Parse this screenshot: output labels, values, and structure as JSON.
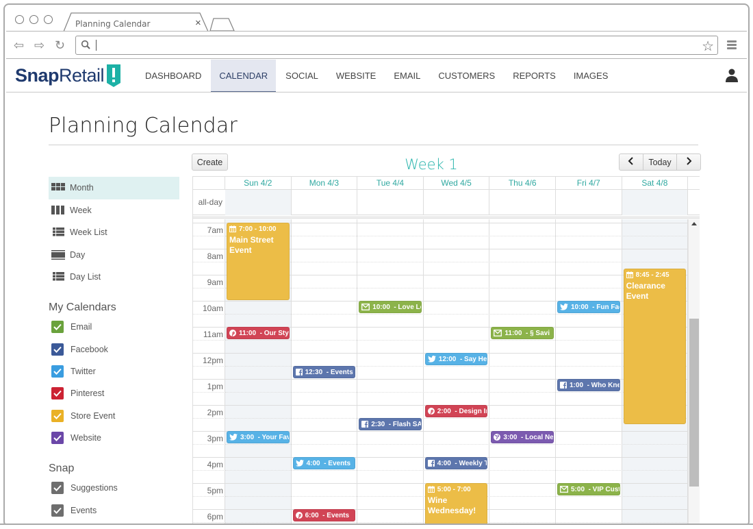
{
  "browser": {
    "tab_title": "Planning Calendar",
    "url": "",
    "icons": [
      "back-arrow-icon",
      "forward-arrow-icon",
      "reload-icon",
      "search-icon",
      "star-icon",
      "menu-icon"
    ]
  },
  "app": {
    "logo_bold": "Snap",
    "logo_light": "Retail",
    "nav": [
      {
        "label": "DASHBOARD",
        "active": false
      },
      {
        "label": "CALENDAR",
        "active": true
      },
      {
        "label": "SOCIAL",
        "active": false
      },
      {
        "label": "WEBSITE",
        "active": false
      },
      {
        "label": "EMAIL",
        "active": false
      },
      {
        "label": "CUSTOMERS",
        "active": false
      },
      {
        "label": "REPORTS",
        "active": false
      },
      {
        "label": "IMAGES",
        "active": false
      }
    ],
    "brand_color": "#1f3a6e",
    "accent_color": "#2bb5ad"
  },
  "page": {
    "title": "Planning Calendar"
  },
  "sidebar": {
    "views": [
      {
        "label": "Month",
        "icon": "month-grid-icon",
        "active": true
      },
      {
        "label": "Week",
        "icon": "week-columns-icon",
        "active": false
      },
      {
        "label": "Week List",
        "icon": "week-list-icon",
        "active": false
      },
      {
        "label": "Day",
        "icon": "day-icon",
        "active": false
      },
      {
        "label": "Day List",
        "icon": "day-list-icon",
        "active": false
      }
    ],
    "my_calendars_heading": "My Calendars",
    "my_calendars": [
      {
        "label": "Email",
        "color": "#6aa23c",
        "checked": true
      },
      {
        "label": "Facebook",
        "color": "#3b5998",
        "checked": true
      },
      {
        "label": "Twitter",
        "color": "#3a9de0",
        "checked": true
      },
      {
        "label": "Pinterest",
        "color": "#cc2233",
        "checked": true
      },
      {
        "label": "Store Event",
        "color": "#eab126",
        "checked": true
      },
      {
        "label": "Website",
        "color": "#6b47a8",
        "checked": true
      }
    ],
    "snap_heading": "Snap",
    "snap_calendars": [
      {
        "label": "Suggestions",
        "color": "#6e6e6e",
        "checked": true
      },
      {
        "label": "Events",
        "color": "#6e6e6e",
        "checked": true
      }
    ]
  },
  "calendar": {
    "create_label": "Create",
    "week_title": "Week 1",
    "prev_label": "<",
    "today_label": "Today",
    "next_label": ">",
    "allday_label": "all-day",
    "days": [
      {
        "label": "Sun 4/2",
        "weekend": true
      },
      {
        "label": "Mon 4/3",
        "weekend": false
      },
      {
        "label": "Tue 4/4",
        "weekend": false
      },
      {
        "label": "Wed 4/5",
        "weekend": false
      },
      {
        "label": "Thu 4/6",
        "weekend": false
      },
      {
        "label": "Fri 4/7",
        "weekend": false
      },
      {
        "label": "Sat 4/8",
        "weekend": true
      }
    ],
    "first_visible_hour": 7,
    "hours": [
      "7am",
      "8am",
      "9am",
      "10am",
      "11am",
      "12pm",
      "1pm",
      "2pm",
      "3pm",
      "4pm",
      "5pm",
      "6pm"
    ],
    "scroll_position": 0.35,
    "type_colors": {
      "store": "#ecbd47",
      "email": "#8cb34a",
      "facebook": "#5d76ad",
      "twitter": "#57b2e6",
      "pinterest": "#d14455",
      "website": "#7c5bb0"
    },
    "events": [
      {
        "day": 0,
        "start": 7.0,
        "end": 10.0,
        "type": "store",
        "time": "7:00 - 10:00",
        "title": "Main Street Event"
      },
      {
        "day": 0,
        "start": 11.0,
        "end": 11.5,
        "type": "pinterest",
        "time": "11:00",
        "title": "- Our Styl"
      },
      {
        "day": 0,
        "start": 15.0,
        "end": 15.5,
        "type": "twitter",
        "time": "3:00",
        "title": "- Your Fav"
      },
      {
        "day": 1,
        "start": 12.5,
        "end": 13.0,
        "type": "facebook",
        "time": "12:30",
        "title": "- Events"
      },
      {
        "day": 1,
        "start": 16.0,
        "end": 16.5,
        "type": "twitter",
        "time": "4:00",
        "title": "- Events"
      },
      {
        "day": 1,
        "start": 18.0,
        "end": 18.5,
        "type": "pinterest",
        "time": "6:00",
        "title": "- Events"
      },
      {
        "day": 2,
        "start": 10.0,
        "end": 10.5,
        "type": "email",
        "time": "10:00",
        "title": "- Love Lo"
      },
      {
        "day": 2,
        "start": 14.5,
        "end": 15.0,
        "type": "facebook",
        "time": "2:30",
        "title": "- Flash SA"
      },
      {
        "day": 3,
        "start": 12.0,
        "end": 12.5,
        "type": "twitter",
        "time": "12:00",
        "title": "- Say Hey"
      },
      {
        "day": 3,
        "start": 14.0,
        "end": 14.5,
        "type": "pinterest",
        "time": "2:00",
        "title": "- Design In"
      },
      {
        "day": 3,
        "start": 16.0,
        "end": 16.5,
        "type": "facebook",
        "time": "4:00",
        "title": "- Weekly T"
      },
      {
        "day": 3,
        "start": 17.0,
        "end": 19.0,
        "type": "store",
        "time": "5:00 - 7:00",
        "title": "Wine Wednesday!"
      },
      {
        "day": 4,
        "start": 11.0,
        "end": 11.5,
        "type": "email",
        "time": "11:00",
        "title": "- § Savi"
      },
      {
        "day": 4,
        "start": 15.0,
        "end": 15.5,
        "type": "website",
        "time": "3:00",
        "title": "- Local Ne"
      },
      {
        "day": 5,
        "start": 10.0,
        "end": 10.5,
        "type": "twitter",
        "time": "10:00",
        "title": "- Fun Fac"
      },
      {
        "day": 5,
        "start": 13.0,
        "end": 13.5,
        "type": "facebook",
        "time": "1:00",
        "title": "- Who Kne"
      },
      {
        "day": 5,
        "start": 17.0,
        "end": 17.5,
        "type": "email",
        "time": "5:00",
        "title": "- VIP Cust"
      },
      {
        "day": 6,
        "start": 8.75,
        "end": 14.75,
        "type": "store",
        "time": "8:45 - 2:45",
        "title": "Clearance Event"
      }
    ]
  }
}
